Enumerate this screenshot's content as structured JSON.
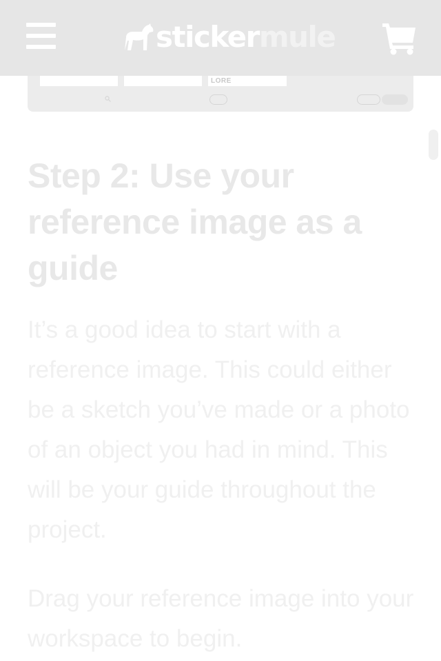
{
  "header": {
    "logo": {
      "part1": "sticker",
      "part2": "mule"
    },
    "icons": {
      "menu": "hamburger-menu-icon",
      "logo_mark": "mule-icon",
      "cart": "shopping-cart-icon"
    },
    "colors": {
      "background": "#e6e6e6",
      "foreground": "#ffffff"
    }
  },
  "screenshot": {
    "thumb_label": "LORE"
  },
  "article": {
    "step_title": "Step 2: Use your reference image as a guide",
    "paragraph_1": "It’s a good idea to start with a reference image. This could either be a sketch you’ve made or a photo of an object you had in mind. This will be your guide throughout the project.",
    "paragraph_2": "Drag your reference image into your workspace to begin."
  }
}
